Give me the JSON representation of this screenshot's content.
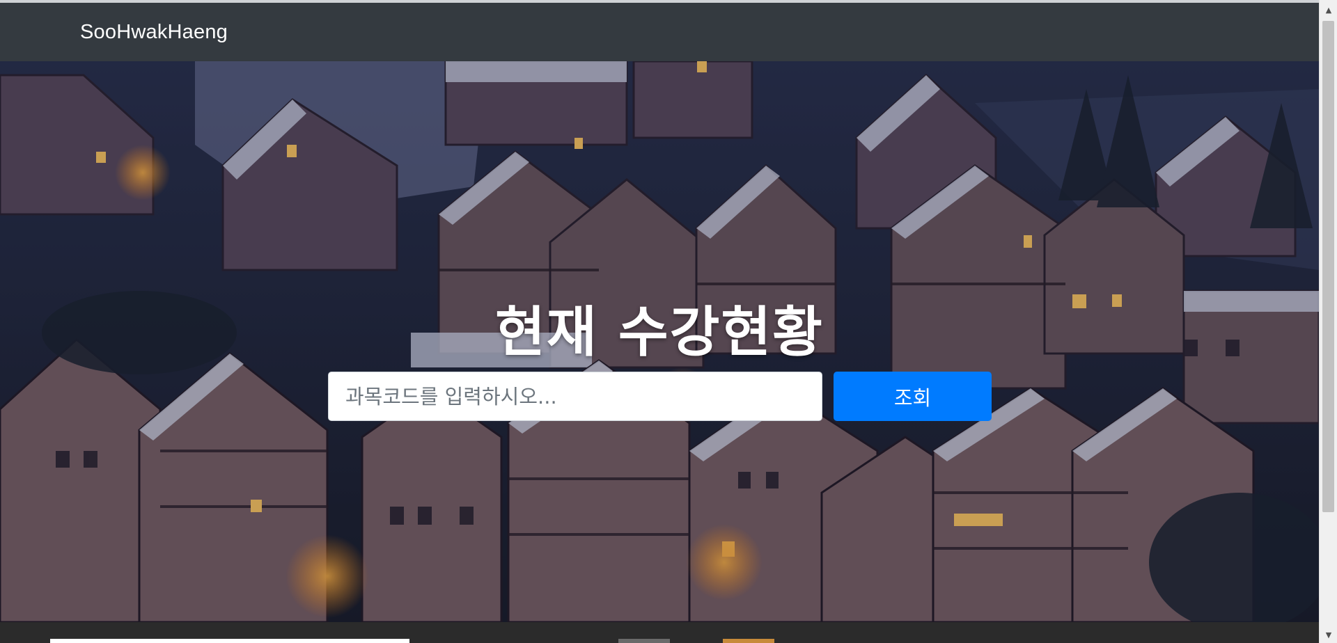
{
  "navbar": {
    "brand": "SooHwakHaeng"
  },
  "hero": {
    "title": "현재 수강현황",
    "background_icon": "village-night-photo"
  },
  "search": {
    "placeholder": "과목코드를 입력하시오...",
    "value": "",
    "button_label": "조회"
  },
  "colors": {
    "navbar": "#343a40",
    "button": "#007bff",
    "text_light": "#ffffff"
  },
  "scrollbar": {
    "up_icon": "chevron-up-icon",
    "down_icon": "chevron-down-icon"
  }
}
